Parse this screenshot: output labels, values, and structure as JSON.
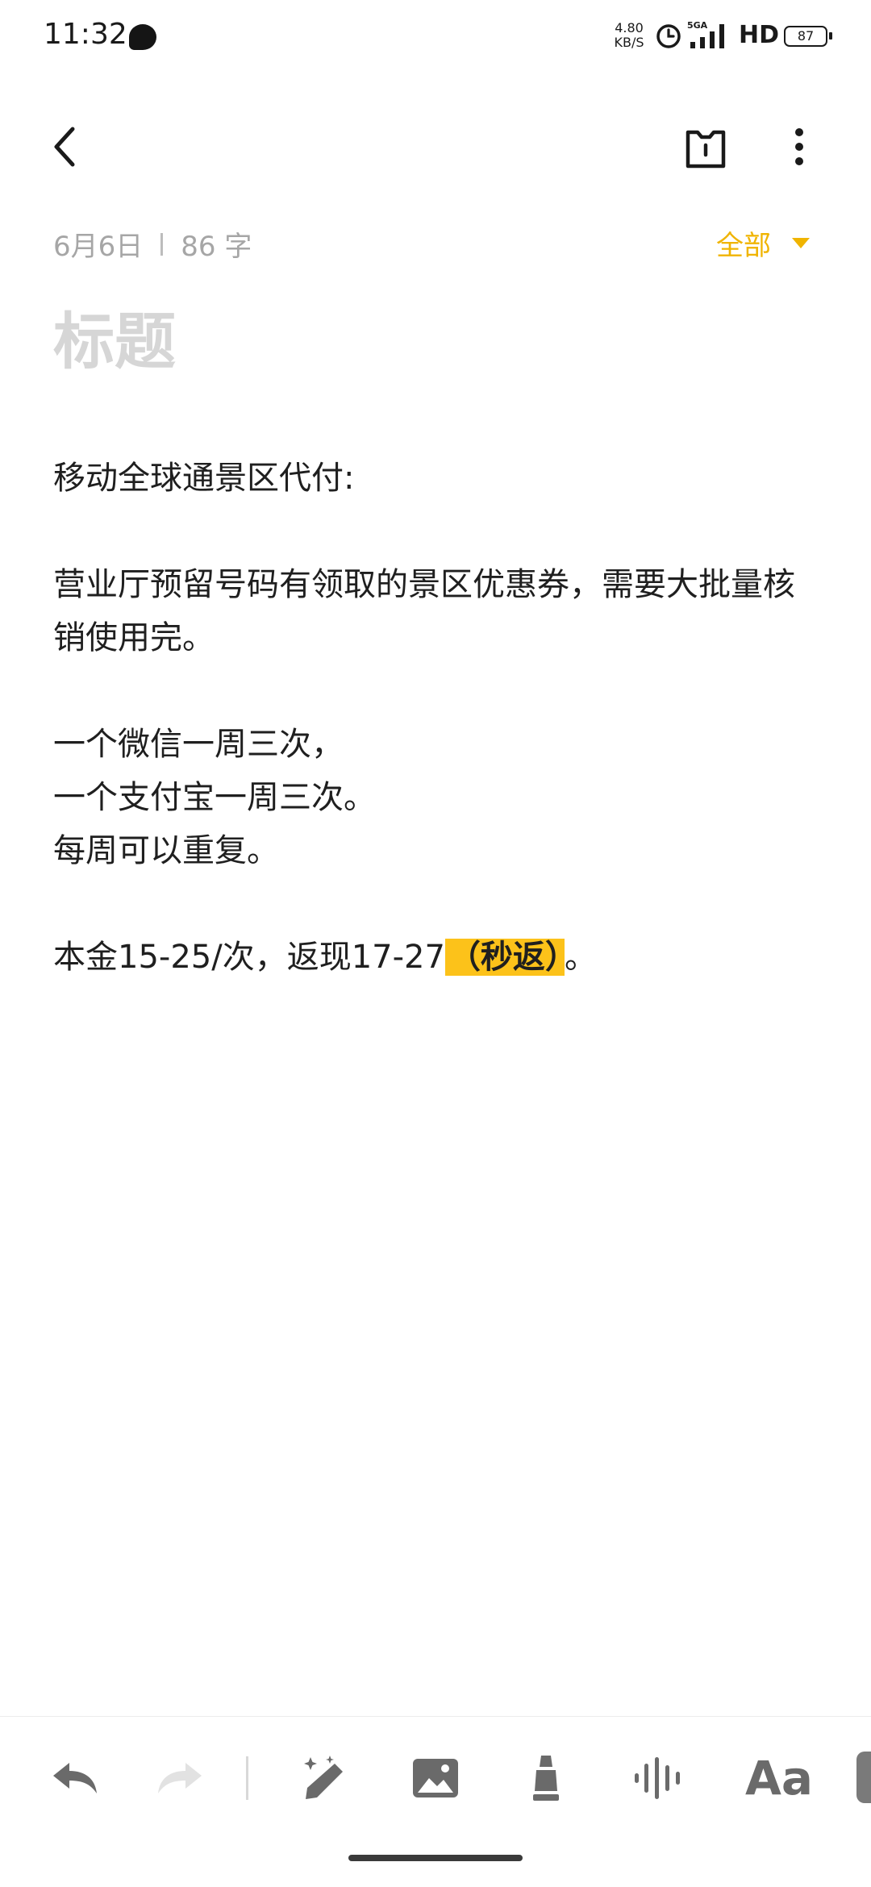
{
  "status_bar": {
    "time": "11:32",
    "net_speed_top": "4.80",
    "net_speed_bottom": "KB/S",
    "network_label": "5GA",
    "hd_label": "HD",
    "battery": "87"
  },
  "header": {
    "back_icon": "chevron-left-icon",
    "share_icon": "share-note-icon",
    "more_icon": "more-vertical-icon"
  },
  "meta": {
    "date": "6月6日",
    "word_count": "86 字",
    "folder_label": "全部"
  },
  "note": {
    "title_placeholder": "标题",
    "p1": "移动全球通景区代付:",
    "p2": "营业厅预留号码有领取的景区优惠券，需要大批量核销使用完。",
    "p3_line1": "一个微信一周三次，",
    "p3_line2": "一个支付宝一周三次。",
    "p3_line3": "每周可以重复。",
    "p4_before": "本金15-25/次，返现17-27",
    "p4_highlight": "（秒返）",
    "p4_after": "。"
  },
  "colors": {
    "accent": "#f0b400",
    "highlight": "#fcc21a",
    "icon_gray": "#6a6a6a"
  },
  "toolbar": {
    "undo_icon": "undo-icon",
    "redo_icon": "redo-icon",
    "ai_pen_icon": "magic-pen-icon",
    "image_icon": "image-icon",
    "marker_icon": "highlighter-icon",
    "audio_icon": "audio-wave-icon",
    "format_label": "Aa"
  }
}
